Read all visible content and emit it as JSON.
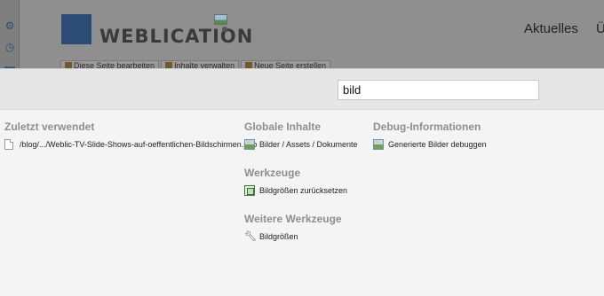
{
  "background_page": {
    "logo_text": "WEBLICATION",
    "nav": {
      "item1": "Aktuelles",
      "item2": "Ü"
    },
    "toolbar": {
      "edit": "Diese Seite bearbeiten",
      "manage": "Inhalte verwalten",
      "create": "Neue Seite erstellen"
    },
    "left_icons": [
      "gear-icon",
      "clock-icon",
      "folder-icon"
    ]
  },
  "search": {
    "value": "bild"
  },
  "recent": {
    "heading": "Zuletzt verwendet",
    "items": [
      {
        "label": "/blog/.../Weblic-TV-Slide-Shows-auf-oeffentlichen-Bildschirmen.php",
        "icon": "file-icon"
      }
    ]
  },
  "global": {
    "heading": "Globale Inhalte",
    "items": [
      {
        "label": "Bilder / Assets / Dokumente",
        "icon": "image-icon"
      }
    ]
  },
  "tools": {
    "heading": "Werkzeuge",
    "items": [
      {
        "label": "Bildgrößen zurücksetzen",
        "icon": "resize-icon"
      }
    ]
  },
  "more_tools": {
    "heading": "Weitere Werkzeuge",
    "items": [
      {
        "label": "Bildgrößen",
        "icon": "wrench-icon"
      }
    ]
  },
  "debug": {
    "heading": "Debug-Informationen",
    "items": [
      {
        "label": "Generierte Bilder debuggen",
        "icon": "image-icon"
      }
    ]
  }
}
